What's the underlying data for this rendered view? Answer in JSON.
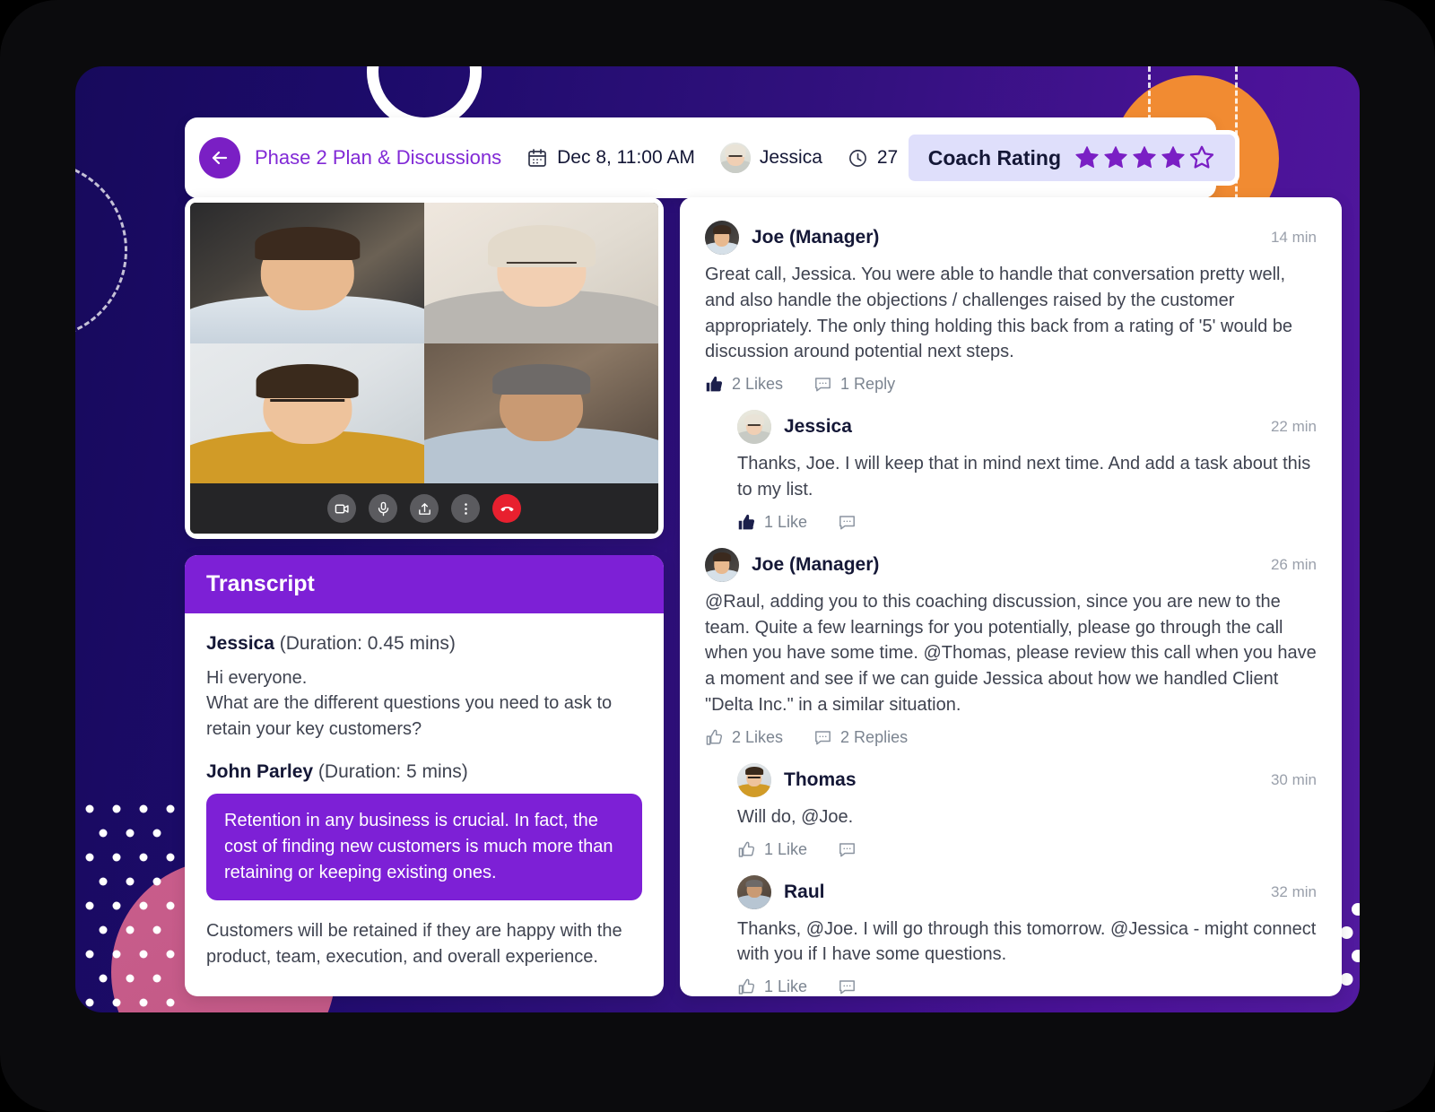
{
  "header": {
    "back_icon": "arrow-left-icon",
    "title": "Phase 2 Plan & Discussions",
    "date_icon": "calendar-icon",
    "date": "Dec 8, 11:00 AM",
    "attendee": "Jessica",
    "duration_icon": "clock-icon",
    "duration": "27 mins",
    "coach_rating_label": "Coach Rating",
    "coach_rating_value": 4,
    "coach_rating_max": 5
  },
  "video": {
    "controls": [
      {
        "name": "camera-icon",
        "label": "Camera"
      },
      {
        "name": "microphone-icon",
        "label": "Microphone"
      },
      {
        "name": "share-screen-icon",
        "label": "Share screen"
      },
      {
        "name": "more-options-icon",
        "label": "More options"
      },
      {
        "name": "end-call-icon",
        "label": "End call"
      }
    ],
    "participants": [
      "Participant 1",
      "Participant 2",
      "Participant 3",
      "Participant 4"
    ]
  },
  "transcript": {
    "title": "Transcript",
    "entries": [
      {
        "speaker": "Jessica",
        "duration": "(Duration: 0.45 mins)",
        "lines": [
          "Hi everyone.",
          "What are the different questions you need to ask to retain your key customers?"
        ],
        "highlight": ""
      },
      {
        "speaker": "John Parley",
        "duration": "(Duration: 5 mins)",
        "highlight": "Retention in any business is crucial. In fact, the cost of finding new customers is much more than retaining or keeping existing ones.",
        "lines": [
          "Customers will be retained if they are happy with the product, team, execution, and overall experience."
        ]
      }
    ]
  },
  "comments": [
    {
      "author": "Joe (Manager)",
      "time": "14 min",
      "body": "Great call, Jessica. You were able to handle that conversation pretty well, and also handle the objections / challenges raised by the customer appropriately. The only thing holding this back from a rating of '5' would be discussion around potential next steps.",
      "likes_label": "2 Likes",
      "replies_label": "1 Reply",
      "like_filled": true,
      "is_reply": false
    },
    {
      "author": "Jessica",
      "time": "22 min",
      "body": "Thanks, Joe. I will keep that in mind next time. And add a task about this to my list.",
      "likes_label": "1 Like",
      "replies_label": "",
      "like_filled": true,
      "is_reply": true
    },
    {
      "author": "Joe (Manager)",
      "time": "26 min",
      "body": "@Raul, adding you to this coaching discussion, since you are new to the team. Quite a few learnings for you potentially, please go through the call when you have some time. @Thomas, please review this call when you have a moment and see if we can guide Jessica about how we handled Client \"Delta Inc.\" in a similar situation.",
      "likes_label": "2 Likes",
      "replies_label": "2 Replies",
      "like_filled": false,
      "is_reply": false
    },
    {
      "author": "Thomas",
      "time": "30 min",
      "body": "Will do, @Joe.",
      "likes_label": "1 Like",
      "replies_label": "",
      "like_filled": false,
      "is_reply": true
    },
    {
      "author": "Raul",
      "time": "32 min",
      "body": "Thanks, @Joe. I will go through this tomorrow. @Jessica - might connect with you if I have some questions.",
      "likes_label": "1 Like",
      "replies_label": "",
      "like_filled": false,
      "is_reply": true
    }
  ],
  "colors": {
    "brand_purple": "#7d20d6",
    "accent_orange": "#f18b32",
    "accent_pink": "#d8648f",
    "bg_navy": "#170a5c",
    "bg_purple": "#4b1298",
    "rating_star": "#7a1fc4",
    "title_text": "#8129d6"
  }
}
